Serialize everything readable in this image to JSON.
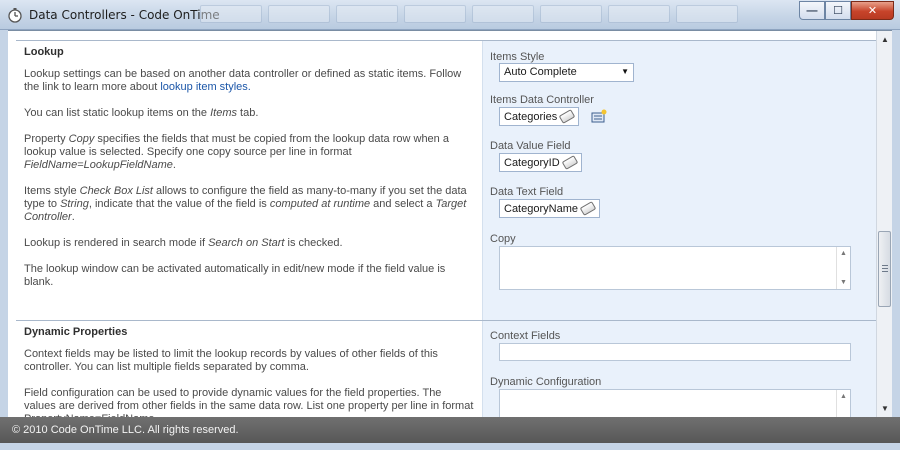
{
  "window": {
    "title": "Data Controllers - Code OnTime",
    "minimize_label": "—",
    "maximize_label": "☐",
    "close_label": "✕"
  },
  "lookup": {
    "title": "Lookup",
    "p1_a": "Lookup settings can be based on another data controller or defined as static items. Follow the link to learn more about ",
    "p1_link": "lookup item styles.",
    "p2_a": "You can list static lookup items on the ",
    "p2_em": "Items",
    "p2_b": " tab.",
    "p3_a": "Property ",
    "p3_em1": "Copy",
    "p3_b": " specifies the fields that must be copied from the lookup data row when a lookup value is selected. Specify one copy source per line in format ",
    "p3_em2": "FieldName=LookupFieldName",
    "p3_c": ".",
    "p4_a": "Items style ",
    "p4_em1": "Check Box List",
    "p4_b": " allows to configure the field as many-to-many if you set the data type to ",
    "p4_em2": "String",
    "p4_c": ", indicate that the value of the field is ",
    "p4_em3": "computed at runtime",
    "p4_d": " and select a ",
    "p4_em4": "Target Controller",
    "p4_e": ".",
    "p5_a": "Lookup is rendered in search mode if ",
    "p5_em": "Search on Start",
    "p5_b": " is checked.",
    "p6": "The lookup window can be activated automatically in edit/new mode if the field value is blank.",
    "fields": {
      "items_style_label": "Items Style",
      "items_style_value": "Auto Complete",
      "items_dc_label": "Items Data Controller",
      "items_dc_value": "Categories",
      "data_value_label": "Data Value Field",
      "data_value_value": "CategoryID",
      "data_text_label": "Data Text Field",
      "data_text_value": "CategoryName",
      "copy_label": "Copy"
    }
  },
  "dynamic": {
    "title": "Dynamic Properties",
    "p1": "Context fields may be listed to limit the lookup records by values of other fields of this controller. You can list multiple fields separated by comma.",
    "p2": "Field configuration can be used to provide dynamic values for the field properties. The values are derived from other fields in the same data row. List one property per line in format PropertyName=FieldName.",
    "context_label": "Context Fields",
    "dynamic_config_label": "Dynamic Configuration"
  },
  "footer": {
    "text": "© 2010 Code OnTime LLC. All rights reserved."
  },
  "colors": {
    "accent": "#1b56a8",
    "right_panel": "#e9f1fb",
    "footer": "#5e5e5e"
  }
}
